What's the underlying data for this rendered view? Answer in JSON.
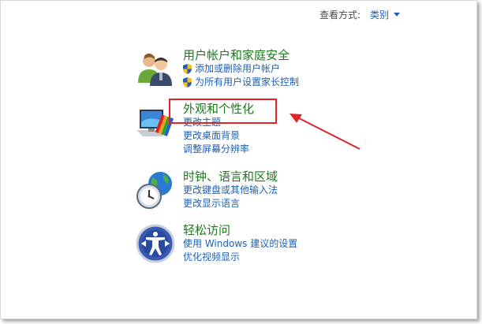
{
  "view_by": {
    "label": "查看方式:",
    "value": "类别"
  },
  "categories": [
    {
      "title": "用户帐户和家庭安全",
      "icon": "users-icon",
      "links": [
        {
          "label": "添加或删除用户帐户",
          "shield": true
        },
        {
          "label": "为所有用户设置家长控制",
          "shield": true
        }
      ]
    },
    {
      "title": "外观和个性化",
      "icon": "appearance-icon",
      "links": [
        {
          "label": "更改主题"
        },
        {
          "label": "更改桌面背景"
        },
        {
          "label": "调整屏幕分辨率"
        }
      ]
    },
    {
      "title": "时钟、语言和区域",
      "icon": "clock-globe-icon",
      "links": [
        {
          "label": "更改键盘或其他输入法"
        },
        {
          "label": "更改显示语言"
        }
      ]
    },
    {
      "title": "轻松访问",
      "icon": "ease-of-access-icon",
      "links": [
        {
          "label": "使用 Windows 建议的设置"
        },
        {
          "label": "优化视频显示"
        }
      ]
    }
  ],
  "colors": {
    "title_green": "#1a7a1a",
    "link_blue": "#1e5fb4",
    "annotation_red": "#e0242a"
  }
}
